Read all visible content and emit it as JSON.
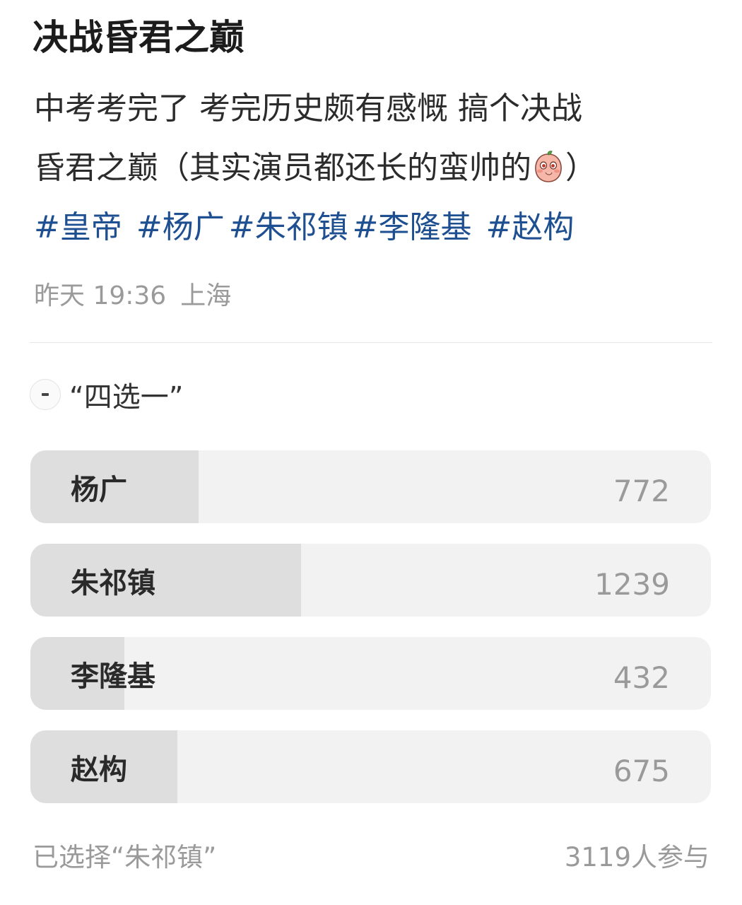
{
  "post": {
    "title": "决战昏君之巅",
    "body_line1": "中考考完了 考完历史颇有感慨 搞个决战",
    "body_line2_before_emoji": "昏君之巅（其实演员都还长的蛮帅的",
    "body_line2_after_emoji": "）",
    "emoji_icon": "blushing-peach-emoji",
    "hashtags": [
      "#皇帝",
      "#杨广",
      "#朱祁镇",
      "#李隆基",
      "#赵构"
    ],
    "hashtag_color": "#1d4f91",
    "time": "昨天 19:36",
    "location": "上海"
  },
  "poll": {
    "title": "“四选一”",
    "options": [
      {
        "label": "杨广",
        "count": "772",
        "votes": 772
      },
      {
        "label": "朱祁镇",
        "count": "1239",
        "votes": 1239
      },
      {
        "label": "李隆基",
        "count": "432",
        "votes": 432
      },
      {
        "label": "赵构",
        "count": "675",
        "votes": 675
      }
    ],
    "max_votes": 3119,
    "selected_text": "已选择“朱祁镇”",
    "participants_text": "3119人参与"
  }
}
